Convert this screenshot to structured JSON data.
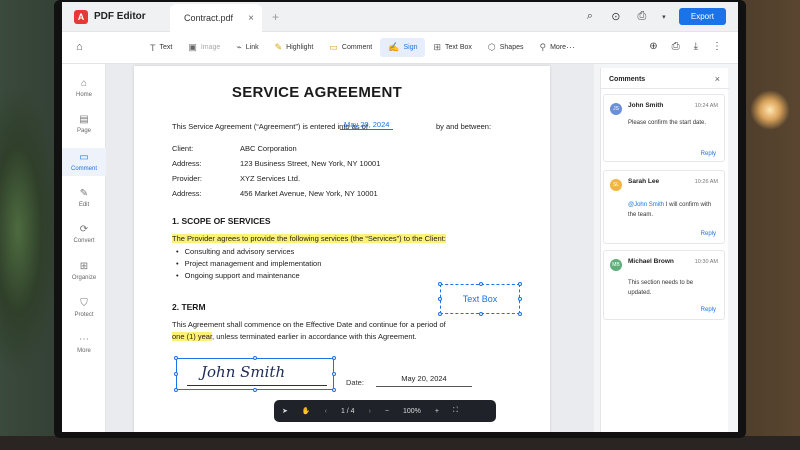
{
  "app": {
    "name": "PDF Editor",
    "logo_glyph": "A",
    "tab_title": "Contract.pdf",
    "tab_close": "×",
    "tab_add": "+",
    "export_label": "Export",
    "brand_color": "#e53935",
    "accent_color": "#1a73e8"
  },
  "titlebar_icons": {
    "search": "⌕",
    "zoom": "⊙",
    "print": "⎙",
    "dropdown": "▾"
  },
  "toolbar": {
    "home_icon": "⌂",
    "tools": [
      {
        "icon": "T",
        "label": "Text"
      },
      {
        "icon": "▣",
        "label": "Image"
      },
      {
        "icon": "⌁",
        "label": "Link"
      },
      {
        "icon": "✎",
        "label": "Highlight"
      },
      {
        "icon": "▭",
        "label": "Comment"
      },
      {
        "icon": "✍",
        "label": "Sign"
      },
      {
        "icon": "⊞",
        "label": "Text Box"
      },
      {
        "icon": "⬡",
        "label": "Shapes"
      },
      {
        "icon": "⚲",
        "label": "More"
      }
    ],
    "more_dots": "···",
    "right_icons": {
      "search": "⊕",
      "print": "⎙",
      "download": "⤓",
      "menu": "⋮"
    }
  },
  "rail": [
    {
      "icon": "⌂",
      "label": "Home"
    },
    {
      "icon": "▤",
      "label": "Page"
    },
    {
      "icon": "▭",
      "label": "Comment"
    },
    {
      "icon": "✎",
      "label": "Edit"
    },
    {
      "icon": "⟳",
      "label": "Convert"
    },
    {
      "icon": "⊞",
      "label": "Organize"
    },
    {
      "icon": "⛉",
      "label": "Protect"
    },
    {
      "icon": "⋯",
      "label": "More"
    }
  ],
  "document": {
    "title": "SERVICE AGREEMENT",
    "intro_start": "This Service Agreement (“Agreement”) is entered into as of",
    "intro_date": "May 20, 2024",
    "intro_end": "by and between:",
    "parties": [
      {
        "label": "Client:",
        "value": "ABC Corporation"
      },
      {
        "label": "Address:",
        "value": "123 Business Street, New York, NY 10001"
      },
      {
        "label": "Provider:",
        "value": "XYZ Services Ltd."
      },
      {
        "label": "Address:",
        "value": "456 Market Avenue, New York, NY 10001"
      }
    ],
    "sec1_title": "1.   SCOPE OF SERVICES",
    "sec1_highlight": "The Provider agrees to provide the following services (the “Services”) to the Client:",
    "bullets": [
      "Consulting and advisory services",
      "Project management and implementation",
      "Ongoing support and maintenance"
    ],
    "sec2_title": "2.   TERM",
    "sec2_line1": "This Agreement shall commence on the Effective Date and continue for a period of",
    "sec2_highlight": "one (1) year",
    "sec2_line2_rest": ", unless terminated earlier in accordance with this Agreement.",
    "textbox_label": "Text Box",
    "signature": "John Smith",
    "date_label": "Date:",
    "date_value": "May 20, 2024"
  },
  "nav": {
    "select_icon": "➤",
    "hand_icon": "✋",
    "prev": "‹",
    "page": "1 / 4",
    "next": "›",
    "zoom_out": "−",
    "zoom": "100%",
    "zoom_in": "+",
    "fullscreen": "⛶"
  },
  "comments": {
    "title": "Comments",
    "close": "×",
    "items": [
      {
        "initials": "JS",
        "color": "#6b8fd6",
        "name": "John Smith",
        "time": "10:24 AM",
        "body": "Please confirm the start date.",
        "reply": "Reply"
      },
      {
        "initials": "SL",
        "color": "#f2b443",
        "name": "Sarah Lee",
        "time": "10:26 AM",
        "mention": "@John Smith",
        "body": " I will confirm with the team.",
        "reply": "Reply"
      },
      {
        "initials": "MB",
        "color": "#5fae7b",
        "name": "Michael Brown",
        "time": "10:30 AM",
        "body": "This section needs to be updated.",
        "reply": "Reply"
      }
    ]
  }
}
